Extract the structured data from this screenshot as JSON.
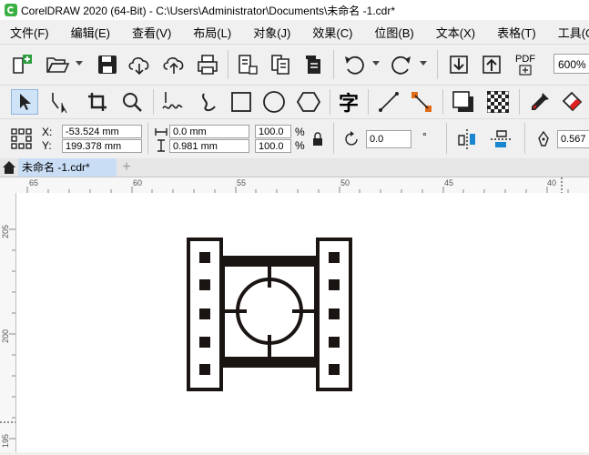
{
  "window": {
    "title": "CorelDRAW 2020 (64-Bit) - C:\\Users\\Administrator\\Documents\\未命名 -1.cdr*"
  },
  "menu": [
    "文件(F)",
    "编辑(E)",
    "查看(V)",
    "布局(L)",
    "对象(J)",
    "效果(C)",
    "位图(B)",
    "文本(X)",
    "表格(T)",
    "工具(O)"
  ],
  "toolbar": {
    "zoom": "600%",
    "pdf_label": "PDF"
  },
  "properties": {
    "x_label": "X:",
    "x_value": "-53.524 mm",
    "y_label": "Y:",
    "y_value": "199.378 mm",
    "width_value": "0.0 mm",
    "height_value": "0.981 mm",
    "scale_w": "100.0",
    "scale_h": "100.0",
    "percent": "%",
    "rotation": "0.0",
    "degree": "°",
    "outline": "0.567"
  },
  "tabs": {
    "document": "未命名 -1.cdr*",
    "add": "+"
  },
  "rulers": {
    "horizontal": [
      "65",
      "60",
      "55",
      "50",
      "45",
      "40"
    ],
    "vertical": [
      "205",
      "200",
      "195"
    ]
  },
  "text_tool_glyph": "字"
}
